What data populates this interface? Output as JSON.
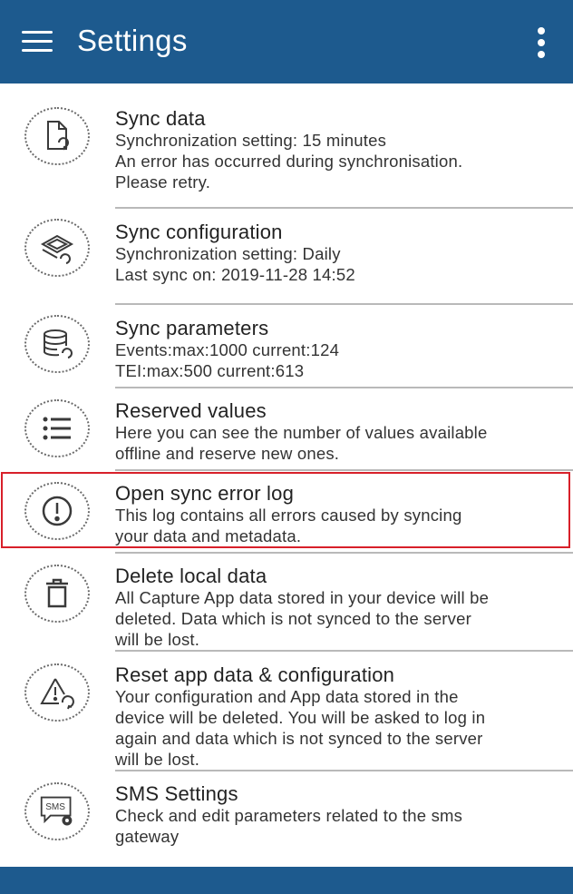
{
  "appbar": {
    "title": "Settings",
    "menu_icon": "hamburger-icon",
    "more_icon": "more-vert-icon"
  },
  "colors": {
    "primary": "#1d5a8e",
    "highlight": "#d8202a"
  },
  "items": [
    {
      "icon": "sync-data-icon",
      "title": "Sync data",
      "desc": [
        "Synchronization setting: 15 minutes",
        "An error has occurred during synchronisation.",
        "Please retry."
      ]
    },
    {
      "icon": "sync-configuration-icon",
      "title": "Sync configuration",
      "desc": [
        "Synchronization setting: Daily",
        "Last sync on: 2019-11-28 14:52"
      ]
    },
    {
      "icon": "sync-parameters-icon",
      "title": "Sync parameters",
      "desc": [
        "Events:max:1000 current:124",
        "TEI:max:500 current:613"
      ]
    },
    {
      "icon": "list-icon",
      "title": "Reserved values",
      "desc": [
        "Here you can see the number of values available",
        "offline and reserve new ones."
      ]
    },
    {
      "icon": "error-icon",
      "title": "Open sync error log",
      "desc": [
        "This log contains all errors caused by syncing",
        "your data and metadata."
      ]
    },
    {
      "icon": "trash-icon",
      "title": "Delete local data",
      "desc": [
        "All Capture App data stored in your device will be",
        "deleted. Data which is not synced to the server",
        "will be lost."
      ]
    },
    {
      "icon": "reset-icon",
      "title": "Reset app data & configuration",
      "desc": [
        "Your configuration and App data stored in the",
        "device will be deleted. You will be asked to log in",
        "again and data which is not synced to the server",
        "will be lost."
      ]
    },
    {
      "icon": "sms-settings-icon",
      "sms_badge": "SMS",
      "title": "SMS Settings",
      "desc": [
        "Check and edit parameters related to the sms",
        "gateway"
      ]
    }
  ]
}
